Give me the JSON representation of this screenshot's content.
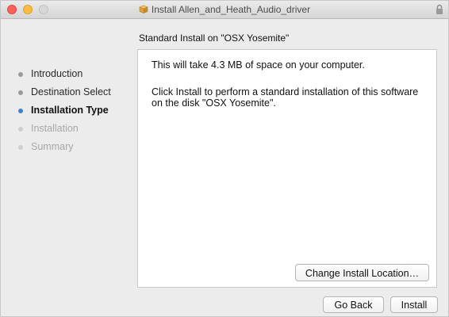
{
  "window": {
    "title": "Install Allen_and_Heath_Audio_driver",
    "subtitle": "Standard Install on \"OSX Yosemite\""
  },
  "sidebar": {
    "steps": [
      {
        "label": "Introduction",
        "state": "done"
      },
      {
        "label": "Destination Select",
        "state": "done"
      },
      {
        "label": "Installation Type",
        "state": "active"
      },
      {
        "label": "Installation",
        "state": "pending"
      },
      {
        "label": "Summary",
        "state": "pending"
      }
    ]
  },
  "content": {
    "space_text": "This will take 4.3 MB of space on your computer.",
    "instruction_text": "Click Install to perform a standard installation of this software on the disk \"OSX Yosemite\"."
  },
  "buttons": {
    "change_location": "Change Install Location…",
    "go_back": "Go Back",
    "install": "Install"
  },
  "colors": {
    "active_dot": "#3b82d8",
    "close": "#fc605b",
    "minimize": "#fdbc40"
  }
}
